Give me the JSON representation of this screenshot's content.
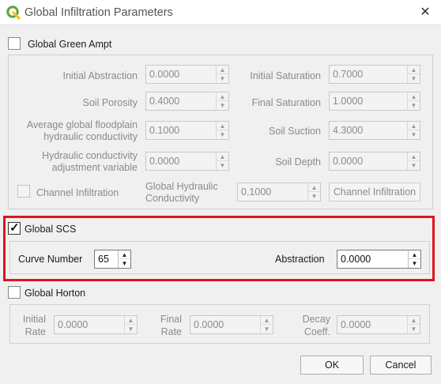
{
  "window": {
    "title": "Global Infiltration Parameters",
    "close_glyph": "✕"
  },
  "green_ampt": {
    "label": "Global Green Ampt",
    "checked": false,
    "fields": {
      "initial_abstraction": {
        "label": "Initial Abstraction",
        "value": "0.0000"
      },
      "initial_saturation": {
        "label": "Initial Saturation",
        "value": "0.7000"
      },
      "soil_porosity": {
        "label": "Soil Porosity",
        "value": "0.4000"
      },
      "final_saturation": {
        "label": "Final Saturation",
        "value": "1.0000"
      },
      "floodplain_conductivity": {
        "label_line1": "Average global floodplain",
        "label_line2": "hydraulic conductivity",
        "value": "0.1000"
      },
      "soil_suction": {
        "label": "Soil Suction",
        "value": "4.3000"
      },
      "conductivity_adjustment": {
        "label_line1": "Hydraulic conductivity",
        "label_line2": "adjustment variable",
        "value": "0.0000"
      },
      "soil_depth": {
        "label": "Soil Depth",
        "value": "0.0000"
      },
      "global_hydraulic_conductivity": {
        "label_line1": "Global Hydraulic",
        "label_line2": "Conductivity",
        "value": "0.1000"
      }
    },
    "channel_infiltration_checkbox": "Channel Infiltration",
    "channel_infiltration_button": "Channel Infiltration"
  },
  "scs": {
    "label": "Global SCS",
    "checked": true,
    "curve_number": {
      "label": "Curve Number",
      "value": "65"
    },
    "abstraction": {
      "label": "Abstraction",
      "value": "0.0000"
    }
  },
  "horton": {
    "label": "Global Horton",
    "checked": false,
    "initial_rate": {
      "label_line1": "Initial",
      "label_line2": "Rate",
      "value": "0.0000"
    },
    "final_rate": {
      "label_line1": "Final",
      "label_line2": "Rate",
      "value": "0.0000"
    },
    "decay_coeff": {
      "label_line1": "Decay",
      "label_line2": "Coeff.",
      "value": "0.0000"
    }
  },
  "buttons": {
    "ok": "OK",
    "cancel": "Cancel"
  },
  "colors": {
    "highlight": "#e0141e",
    "qgis_green": "#5ba43b",
    "qgis_yellow": "#f0c419"
  }
}
